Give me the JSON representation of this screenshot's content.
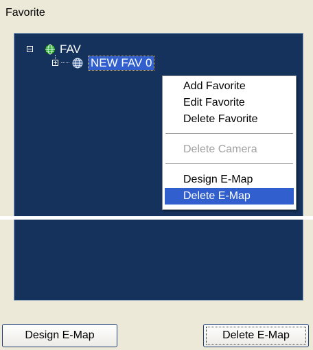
{
  "favorite_panel": {
    "group_label": "Favorite",
    "tree": {
      "root": {
        "label": "FAV",
        "expanded": true,
        "icon": "globe-icon-green"
      },
      "child": {
        "label": "NEW FAV 0",
        "expanded": false,
        "selected": true,
        "icon": "globe-icon-blue"
      }
    },
    "context_menu": {
      "items": [
        {
          "label": "Add Favorite",
          "enabled": true
        },
        {
          "label": "Edit Favorite",
          "enabled": true
        },
        {
          "label": "Delete Favorite",
          "enabled": true
        },
        {
          "label": "Delete Camera",
          "enabled": false
        },
        {
          "label": "Design E-Map",
          "enabled": true
        },
        {
          "label": "Delete E-Map",
          "enabled": true,
          "highlighted": true
        }
      ]
    }
  },
  "emap_panel": {
    "design_button": "Design E-Map",
    "delete_button": "Delete E-Map"
  },
  "colors": {
    "panel_bg": "#ece9d8",
    "tree_bg": "#14325c",
    "selection": "#3160ce",
    "disabled_text": "#a0a0a0"
  }
}
